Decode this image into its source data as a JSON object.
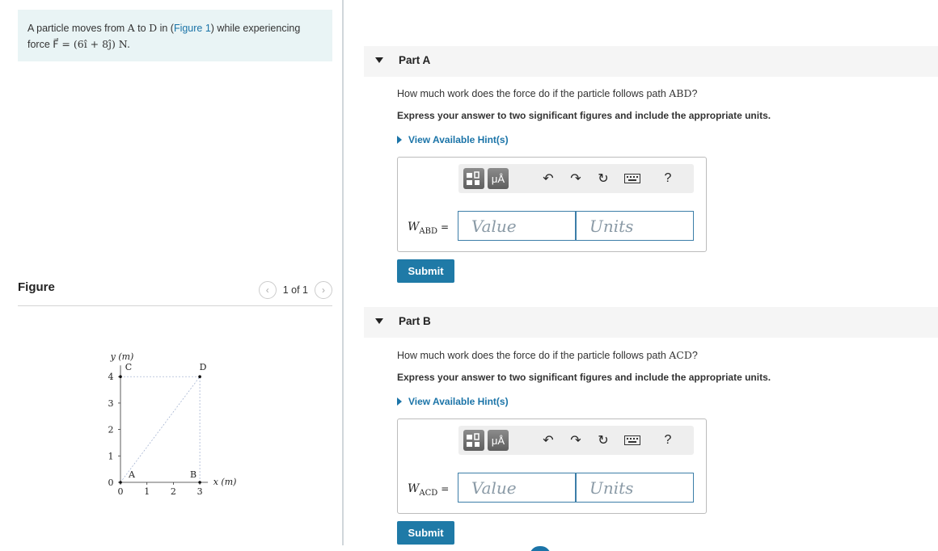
{
  "problem": {
    "line1_pre": "A particle moves from ",
    "point_a": "A",
    "mid1": " to ",
    "point_d": "D",
    "mid2": " in (",
    "figure_link": "Figure 1",
    "line1_post": ") while experiencing",
    "line2_pre": "force ",
    "force_expr": "F⃗ = (6î + 8ĵ) N."
  },
  "figure": {
    "title": "Figure",
    "pager_text": "1 of 1",
    "prev_icon": "chevron-left-icon",
    "next_icon": "chevron-right-icon",
    "y_axis_label": "y (m)",
    "x_axis_label": "x (m)",
    "x_ticks": [
      "0",
      "1",
      "2",
      "3"
    ],
    "y_ticks": [
      "0",
      "1",
      "2",
      "3",
      "4"
    ],
    "points": [
      {
        "label": "A",
        "x": 0,
        "y": 0
      },
      {
        "label": "B",
        "x": 3,
        "y": 0
      },
      {
        "label": "C",
        "x": 0,
        "y": 4
      },
      {
        "label": "D",
        "x": 3,
        "y": 4
      }
    ]
  },
  "toolbar": {
    "templates_icon": "templates-icon",
    "units_label": "μÅ",
    "undo_icon": "undo-icon",
    "redo_icon": "redo-icon",
    "reset_icon": "reset-icon",
    "keyboard_icon": "keyboard-icon",
    "help_label": "?"
  },
  "parts": [
    {
      "label": "Part A",
      "question_pre": "How much work does the force do if the particle follows path ",
      "path": "ABD",
      "question_post": "?",
      "instruction": "Express your answer to two significant figures and include the appropriate units.",
      "hint": "View Available Hint(s)",
      "var_main": "W",
      "var_sub": "ABD",
      "equals": "=",
      "value_placeholder": "Value",
      "units_placeholder": "Units",
      "submit": "Submit"
    },
    {
      "label": "Part B",
      "question_pre": "How much work does the force do if the particle follows path ",
      "path": "ACD",
      "question_post": "?",
      "instruction": "Express your answer to two significant figures and include the appropriate units.",
      "hint": "View Available Hint(s)",
      "var_main": "W",
      "var_sub": "ACD",
      "equals": "=",
      "value_placeholder": "Value",
      "units_placeholder": "Units",
      "submit": "Submit"
    }
  ]
}
